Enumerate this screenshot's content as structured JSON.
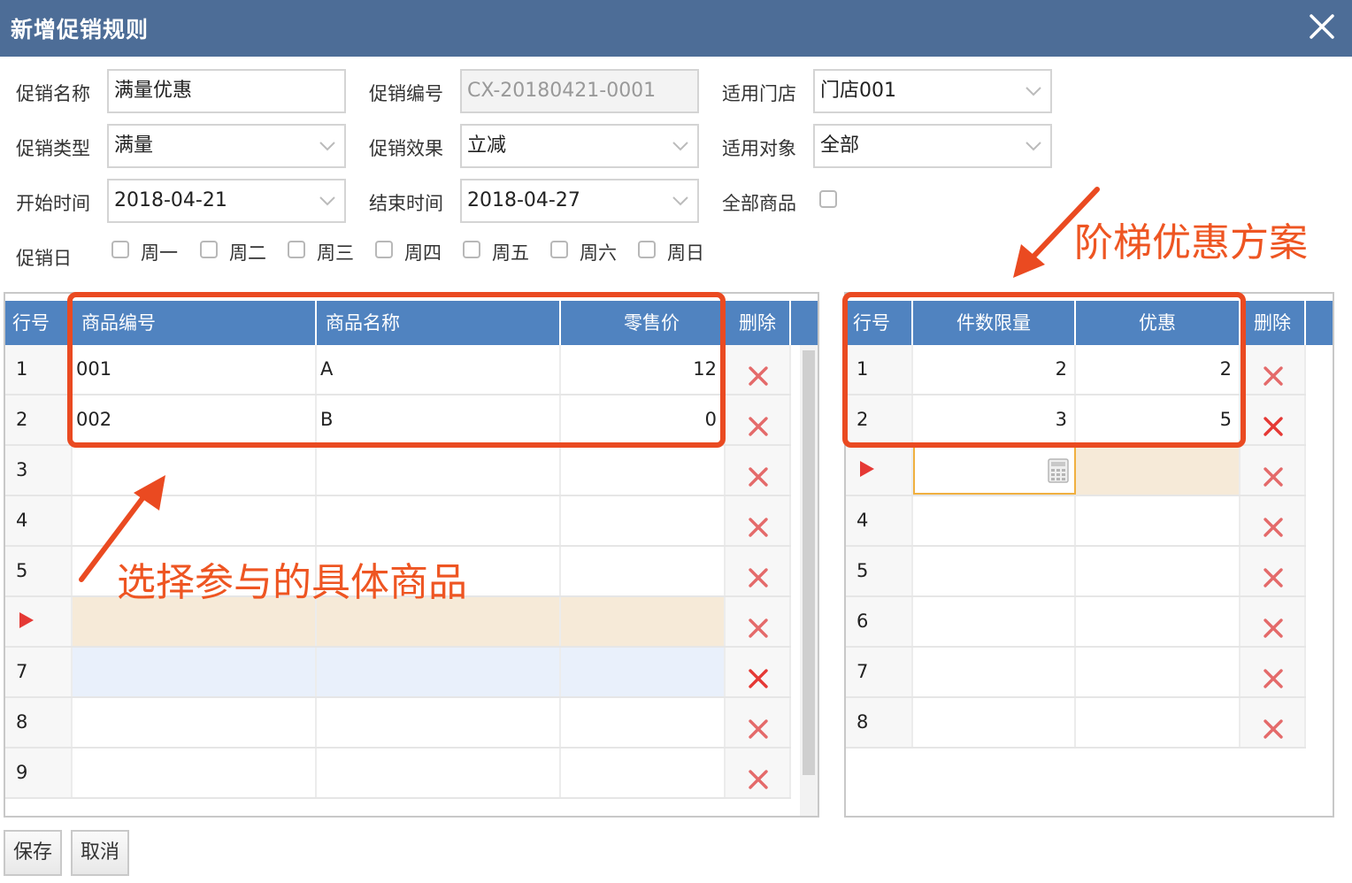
{
  "window": {
    "title": "新增促销规则"
  },
  "form": {
    "name_label": "促销名称",
    "name_value": "满量优惠",
    "code_label": "促销编号",
    "code_value": "CX-20180421-0001",
    "store_label": "适用门店",
    "store_value": "门店001",
    "type_label": "促销类型",
    "type_value": "满量",
    "effect_label": "促销效果",
    "effect_value": "立减",
    "target_label": "适用对象",
    "target_value": "全部",
    "start_label": "开始时间",
    "start_value": "2018-04-21",
    "end_label": "结束时间",
    "end_value": "2018-04-27",
    "all_goods_label": "全部商品",
    "days_label": "促销日",
    "days": [
      "周一",
      "周二",
      "周三",
      "周四",
      "周五",
      "周六",
      "周日"
    ]
  },
  "goods_grid": {
    "headers": {
      "row": "行号",
      "code": "商品编号",
      "name": "商品名称",
      "price": "零售价",
      "delete": "删除"
    },
    "rows": [
      {
        "no": "1",
        "code": "001",
        "name": "A",
        "price": "12"
      },
      {
        "no": "2",
        "code": "002",
        "name": "B",
        "price": "0"
      },
      {
        "no": "3",
        "code": "",
        "name": "",
        "price": ""
      },
      {
        "no": "4",
        "code": "",
        "name": "",
        "price": ""
      },
      {
        "no": "5",
        "code": "",
        "name": "",
        "price": ""
      },
      {
        "no": "",
        "code": "",
        "name": "",
        "price": "",
        "current": true
      },
      {
        "no": "7",
        "code": "",
        "name": "",
        "price": ""
      },
      {
        "no": "8",
        "code": "",
        "name": "",
        "price": ""
      },
      {
        "no": "9",
        "code": "",
        "name": "",
        "price": ""
      }
    ]
  },
  "tier_grid": {
    "headers": {
      "row": "行号",
      "qty": "件数限量",
      "discount": "优惠",
      "delete": "删除"
    },
    "rows": [
      {
        "no": "1",
        "qty": "2",
        "discount": "2"
      },
      {
        "no": "2",
        "qty": "3",
        "discount": "5"
      },
      {
        "no": "",
        "qty": "",
        "discount": "",
        "current": true
      },
      {
        "no": "4",
        "qty": "",
        "discount": ""
      },
      {
        "no": "5",
        "qty": "",
        "discount": ""
      },
      {
        "no": "6",
        "qty": "",
        "discount": ""
      },
      {
        "no": "7",
        "qty": "",
        "discount": ""
      },
      {
        "no": "8",
        "qty": "",
        "discount": ""
      }
    ]
  },
  "annotations": {
    "goods_note": "选择参与的具体商品",
    "tier_note": "阶梯优惠方案"
  },
  "buttons": {
    "save": "保存",
    "cancel": "取消"
  },
  "colors": {
    "titlebar": "#4d6d97",
    "header": "#5083c0",
    "annotation": "#ea4a21",
    "delete": "#e53935"
  }
}
